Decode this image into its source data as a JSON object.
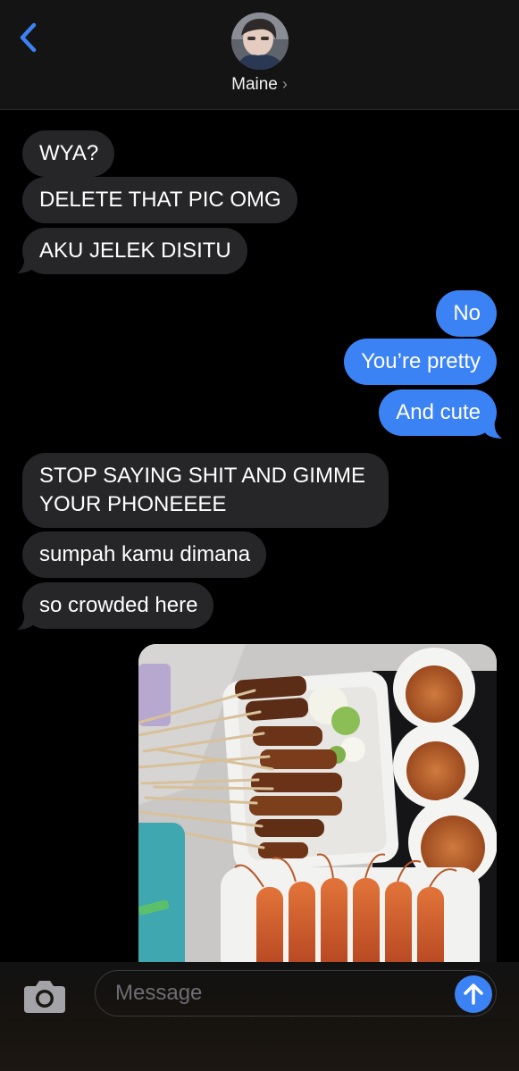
{
  "header": {
    "contact_name": "Maine",
    "chevron": "›",
    "back_icon": "chevron-left-icon"
  },
  "thread": {
    "messages": [
      {
        "direction": "incoming",
        "text": "WYA?"
      },
      {
        "direction": "incoming",
        "text": "DELETE THAT PIC OMG"
      },
      {
        "direction": "incoming",
        "text": "AKU JELEK DISITU"
      },
      {
        "direction": "outgoing",
        "text": "No"
      },
      {
        "direction": "outgoing",
        "text": "You’re pretty"
      },
      {
        "direction": "outgoing",
        "text": "And cute"
      },
      {
        "direction": "incoming",
        "text": "STOP SAYING SHIT AND GIMME"
      },
      {
        "direction": "incoming",
        "text": "YOUR PHONEEEE"
      },
      {
        "direction": "incoming",
        "text": "sumpah kamu dimana"
      },
      {
        "direction": "incoming",
        "text": "so crowded here"
      }
    ],
    "attachment": {
      "type": "photo",
      "subject": "satay, shrimp and peanut sauce"
    }
  },
  "composer": {
    "placeholder": "Message",
    "camera_icon": "camera-icon",
    "send_icon": "arrow-up-icon"
  },
  "colors": {
    "incoming_bubble": "#262628",
    "outgoing_bubble": "#3b82f5",
    "accent": "#3b82f5",
    "background": "#000000"
  }
}
